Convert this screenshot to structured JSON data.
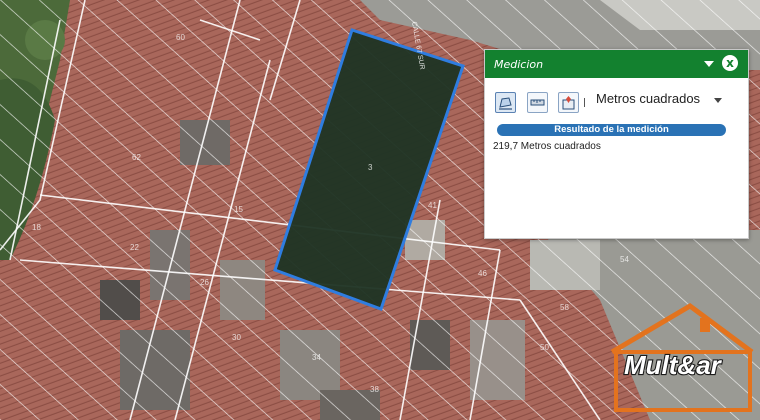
{
  "map": {
    "parcel_labels": [
      "3",
      "60",
      "62",
      "15",
      "18",
      "22",
      "26",
      "30",
      "34",
      "38",
      "41",
      "46",
      "50",
      "54",
      "58"
    ],
    "street_label": "CALLE 67 SUR",
    "colors": {
      "measured_parcel_outline": "#2f7de0",
      "hatch": "#ffffff",
      "roof": "#a8645a"
    }
  },
  "panel": {
    "title": "Medicion",
    "close_label": "x",
    "tools": [
      "area-tool",
      "distance-tool",
      "location-tool"
    ],
    "unit_selected": "Metros cuadrados",
    "result_header": "Resultado de la medición",
    "result_value": "219,7 Metros cuadrados",
    "header_color": "#13812f",
    "result_bar_color": "#2a72b5"
  },
  "logo": {
    "text": "Mult&ar"
  }
}
